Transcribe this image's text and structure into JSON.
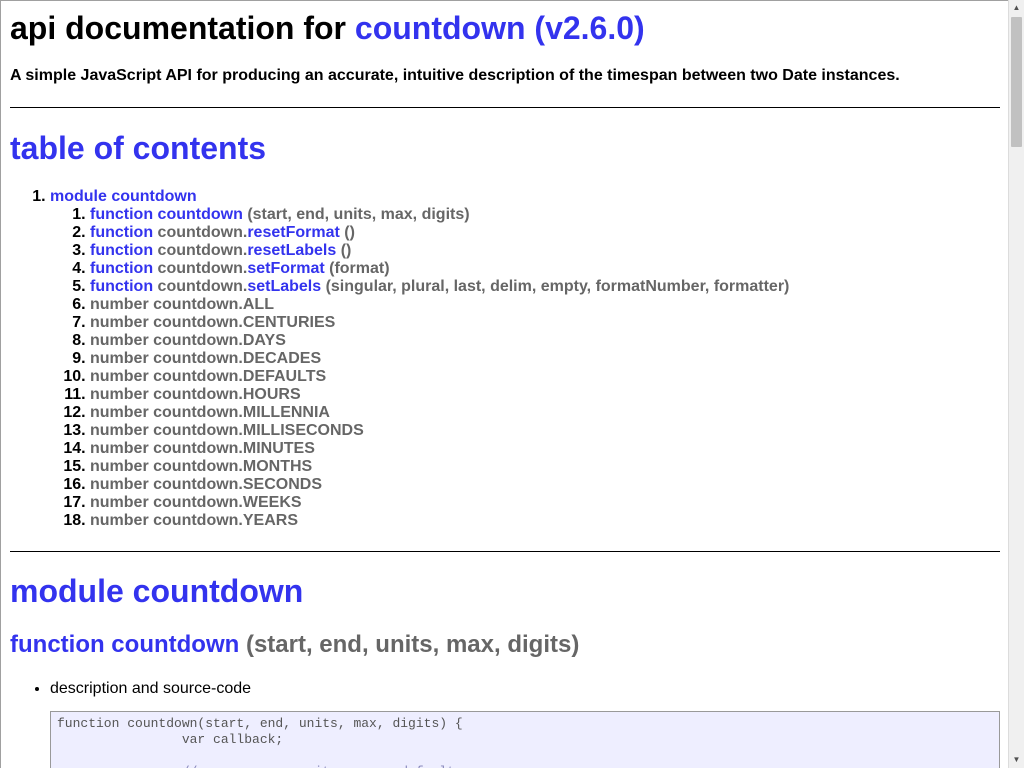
{
  "header": {
    "title_prefix": "api documentation for ",
    "title_link": "countdown (v2.6.0)",
    "description": "A simple JavaScript API for producing an accurate, intuitive description of the timespan between two Date instances."
  },
  "toc": {
    "heading": "table of contents",
    "module_label": "module countdown",
    "items": [
      {
        "num": "1.",
        "kw": "function",
        "obj": "",
        "name": "countdown",
        "args": "(start, end, units, max, digits)"
      },
      {
        "num": "2.",
        "kw": "function",
        "obj": "countdown.",
        "name": "resetFormat",
        "args": "()"
      },
      {
        "num": "3.",
        "kw": "function",
        "obj": "countdown.",
        "name": "resetLabels",
        "args": "()"
      },
      {
        "num": "4.",
        "kw": "function",
        "obj": "countdown.",
        "name": "setFormat",
        "args": "(format)"
      },
      {
        "num": "5.",
        "kw": "function",
        "obj": "countdown.",
        "name": "setLabels",
        "args": "(singular, plural, last, delim, empty, formatNumber, formatter)"
      },
      {
        "num": "6.",
        "text": "number countdown.ALL"
      },
      {
        "num": "7.",
        "text": "number countdown.CENTURIES"
      },
      {
        "num": "8.",
        "text": "number countdown.DAYS"
      },
      {
        "num": "9.",
        "text": "number countdown.DECADES"
      },
      {
        "num": "10.",
        "text": "number countdown.DEFAULTS"
      },
      {
        "num": "11.",
        "text": "number countdown.HOURS"
      },
      {
        "num": "12.",
        "text": "number countdown.MILLENNIA"
      },
      {
        "num": "13.",
        "text": "number countdown.MILLISECONDS"
      },
      {
        "num": "14.",
        "text": "number countdown.MINUTES"
      },
      {
        "num": "15.",
        "text": "number countdown.MONTHS"
      },
      {
        "num": "16.",
        "text": "number countdown.SECONDS"
      },
      {
        "num": "17.",
        "text": "number countdown.WEEKS"
      },
      {
        "num": "18.",
        "text": "number countdown.YEARS"
      }
    ]
  },
  "module": {
    "heading": "module countdown",
    "function_heading_link": "function countdown",
    "function_heading_args": " (start, end, units, max, digits)",
    "bullet": "description and source-code",
    "code_lines": [
      "function countdown(start, end, units, max, digits) {",
      "                var callback;",
      "",
      "                // ensure some units or use defaults"
    ]
  },
  "scrollbar": {
    "up_icon": "▲",
    "down_icon": "▼"
  }
}
